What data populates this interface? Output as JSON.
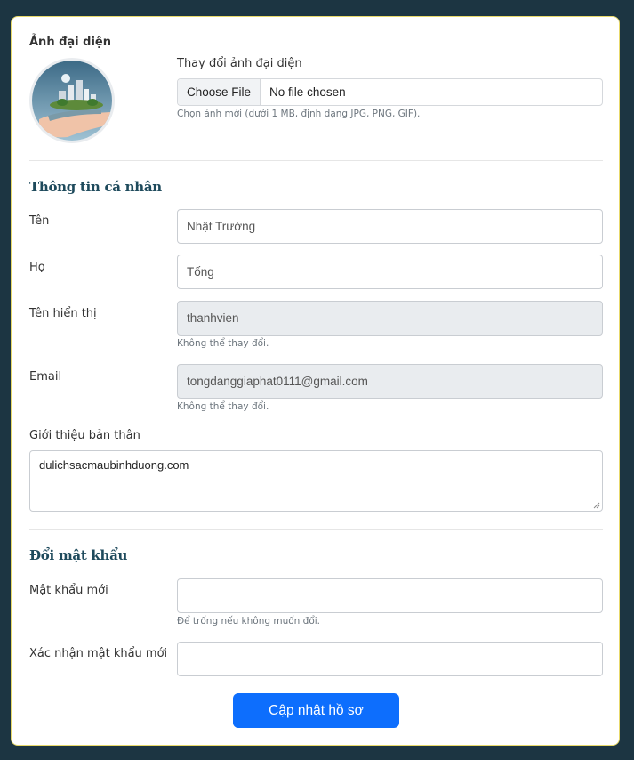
{
  "avatar": {
    "label": "Ảnh đại diện",
    "change_label": "Thay đổi ảnh đại diện",
    "choose_file": "Choose File",
    "no_file": "No file chosen",
    "hint": "Chọn ảnh mới (dưới 1 MB, định dạng JPG, PNG, GIF)."
  },
  "personal": {
    "title": "Thông tin cá nhân",
    "first_name_label": "Tên",
    "first_name": "Nhật Trường",
    "last_name_label": "Họ",
    "last_name": "Tống",
    "display_name_label": "Tên hiển thị",
    "display_name": "thanhvien",
    "display_name_hint": "Không thể thay đổi.",
    "email_label": "Email",
    "email": "tongdanggiaphat0111@gmail.com",
    "email_hint": "Không thể thay đổi.",
    "bio_label": "Giới thiệu bản thân",
    "bio": "dulichsacmaubinhduong.com"
  },
  "password": {
    "title": "Đổi mật khẩu",
    "new_label": "Mật khẩu mới",
    "new_hint": "Để trống nếu không muốn đổi.",
    "confirm_label": "Xác nhận mật khẩu mới"
  },
  "submit_label": "Cập nhật hồ sơ",
  "colors": {
    "background": "#1c3542",
    "primary": "#0d6efd",
    "section_title": "#1e4a5c",
    "card_border": "#e8d96a"
  }
}
